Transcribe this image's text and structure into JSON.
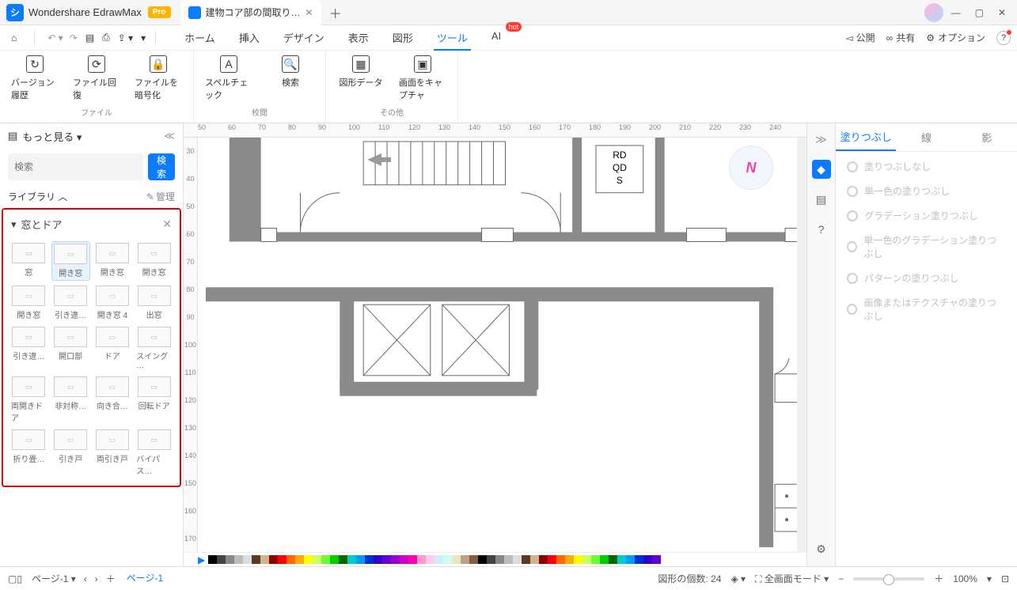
{
  "app": {
    "name": "Wondershare EdrawMax",
    "badge": "Pro"
  },
  "tab": {
    "title": "建物コア部の間取り…"
  },
  "menu": {
    "home": "ホーム",
    "insert": "挿入",
    "design": "デザイン",
    "view": "表示",
    "shape": "図形",
    "tool": "ツール",
    "ai": "AI",
    "hot": "hot"
  },
  "topright": {
    "publish": "公開",
    "share": "共有",
    "option": "オプション"
  },
  "ribbon": {
    "file": {
      "history": "バージョン履歴",
      "recover": "ファイル回復",
      "encrypt": "ファイルを暗号化",
      "label": "ファイル"
    },
    "proof": {
      "spell": "スペルチェック",
      "search": "検索",
      "label": "校閲"
    },
    "other": {
      "shapedata": "図形データ",
      "capture": "画面をキャプチャ",
      "label": "その他"
    }
  },
  "left": {
    "more": "もっと見る",
    "search_ph": "検索",
    "search_btn": "検索",
    "library": "ライブラリ",
    "manage": "管理",
    "category": "窓とドア",
    "shapes": [
      {
        "l": "窓"
      },
      {
        "l": "開き窓",
        "sel": true
      },
      {
        "l": "開き窓"
      },
      {
        "l": "開き窓"
      },
      {
        "l": "開き窓"
      },
      {
        "l": "引き違…"
      },
      {
        "l": "開き窓 4"
      },
      {
        "l": "出窓"
      },
      {
        "l": "引き違…"
      },
      {
        "l": "開口部"
      },
      {
        "l": "ドア"
      },
      {
        "l": "スイング …"
      },
      {
        "l": "両開きドア"
      },
      {
        "l": "非対称…"
      },
      {
        "l": "向き合…"
      },
      {
        "l": "回転ドア"
      },
      {
        "l": "折り畳…"
      },
      {
        "l": "引き戸"
      },
      {
        "l": "両引き戸"
      },
      {
        "l": "バイパス…"
      }
    ]
  },
  "ruler_h": [
    "50",
    "60",
    "70",
    "80",
    "90",
    "100",
    "110",
    "120",
    "130",
    "140",
    "150",
    "160",
    "170",
    "180",
    "190",
    "200",
    "210",
    "220",
    "230",
    "240"
  ],
  "ruler_v": [
    "30",
    "40",
    "50",
    "60",
    "70",
    "80",
    "90",
    "100",
    "110",
    "120",
    "130",
    "140",
    "150",
    "160",
    "170"
  ],
  "canvas_text": {
    "rd": "RD",
    "qd": "QD",
    "s": "S"
  },
  "right": {
    "tabs": {
      "fill": "塗りつぶし",
      "line": "線",
      "shadow": "影"
    },
    "opts": [
      "塗りつぶしなし",
      "単一色の塗りつぶし",
      "グラデーション塗りつぶし",
      "単一色のグラデーション塗りつぶし",
      "パターンの塗りつぶし",
      "画像またはテクスチャの塗りつぶし"
    ]
  },
  "status": {
    "page": "ページ-1",
    "page_tab": "ページ-1",
    "count_label": "図形の個数:",
    "count": "24",
    "mode": "全画面モード",
    "zoom": "100%"
  },
  "palette": [
    "#000",
    "#444",
    "#888",
    "#bbb",
    "#ddd",
    "#5a3a22",
    "#d2b48c",
    "#8b0000",
    "#ff0000",
    "#ff6600",
    "#ffaa00",
    "#ffff00",
    "#ccff66",
    "#66ff33",
    "#00cc00",
    "#006600",
    "#00cccc",
    "#0099ff",
    "#0033cc",
    "#3300cc",
    "#6600cc",
    "#9900cc",
    "#cc00cc",
    "#ff00aa",
    "#ff99cc",
    "#ffccee",
    "#cceeff",
    "#ccffee",
    "#e8e8c0",
    "#c0a080",
    "#806040"
  ]
}
